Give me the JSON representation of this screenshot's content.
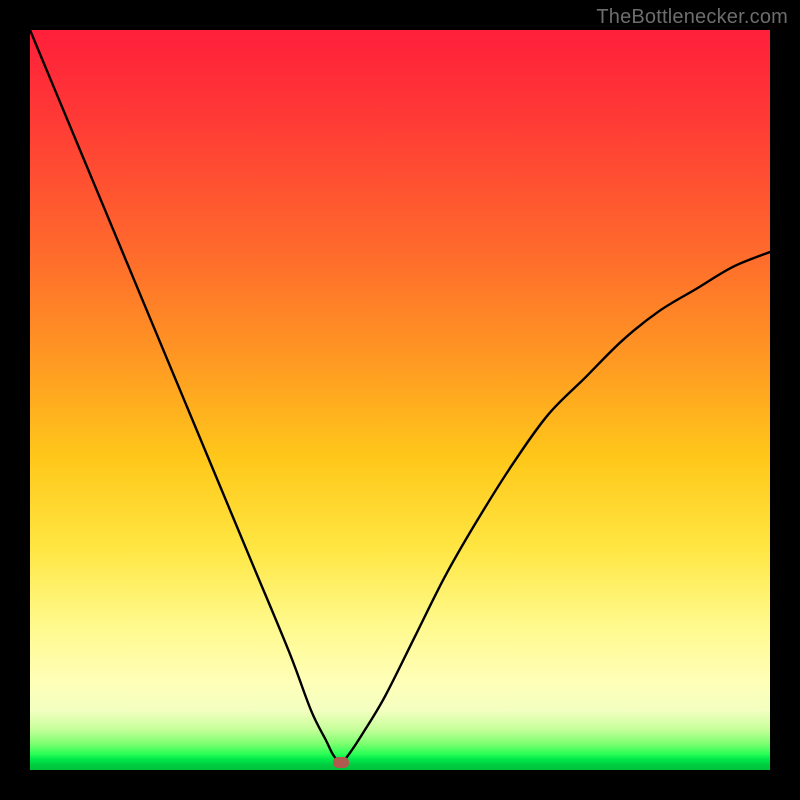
{
  "watermark": "TheBottlenecker.com",
  "chart_data": {
    "type": "line",
    "title": "",
    "xlabel": "",
    "ylabel": "",
    "xlim": [
      0,
      100
    ],
    "ylim": [
      0,
      100
    ],
    "series": [
      {
        "name": "bottleneck-curve",
        "x": [
          0,
          5,
          10,
          15,
          20,
          25,
          30,
          35,
          38,
          40,
          41,
          42,
          43,
          45,
          48,
          52,
          56,
          60,
          65,
          70,
          75,
          80,
          85,
          90,
          95,
          100
        ],
        "y": [
          100,
          88,
          76,
          64,
          52,
          40,
          28,
          16,
          8,
          4,
          2,
          1,
          2,
          5,
          10,
          18,
          26,
          33,
          41,
          48,
          53,
          58,
          62,
          65,
          68,
          70
        ]
      }
    ],
    "min_point": {
      "x": 42,
      "y": 1
    },
    "gradient_stops": [
      {
        "pct": 0,
        "color": "#ff1f3a"
      },
      {
        "pct": 45,
        "color": "#ff9a22"
      },
      {
        "pct": 70,
        "color": "#ffe642"
      },
      {
        "pct": 92,
        "color": "#f3ffc0"
      },
      {
        "pct": 98,
        "color": "#2bff55"
      },
      {
        "pct": 100,
        "color": "#00c23c"
      }
    ]
  }
}
